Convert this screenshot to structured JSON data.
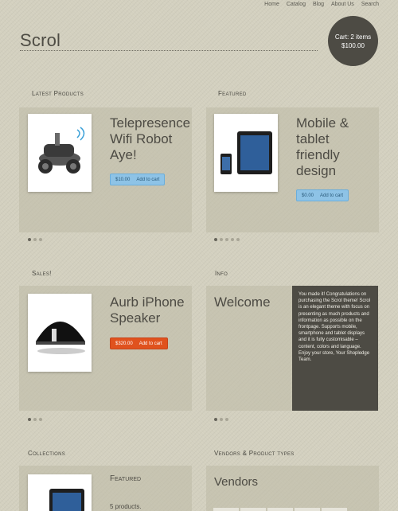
{
  "nav": {
    "items": [
      "Home",
      "Catalog",
      "Blog",
      "About Us",
      "Search"
    ]
  },
  "site": {
    "logo": "Scrol"
  },
  "cart": {
    "line1": "Cart: 2 items",
    "line2": "$100.00"
  },
  "latest": {
    "heading": "Latest Products",
    "product_title": "Telepresence Wifi Robot Aye!",
    "price": "$10.00",
    "add_label": "Add to cart",
    "dots": 3
  },
  "featured": {
    "heading": "Featured",
    "product_title": "Mobile & tablet friendly design",
    "price": "$0.00",
    "add_label": "Add to cart",
    "dots": 5
  },
  "sales": {
    "heading": "Sales!",
    "product_title": "Aurb iPhone Speaker",
    "price": "$320.00",
    "add_label": "Add to cart",
    "dots": 3
  },
  "info": {
    "heading": "Info",
    "title": "Welcome",
    "text": "You made it! Congratulations on purchasing the Scrol theme! Scrol is an elegant theme with focus on presenting as much products and information as possible on the frontpage. Supports mobile, smartphone and tablet displays and it is fully customisable – content, colors and language. Enjoy your store, Your Shopledge Team.",
    "dots": 3
  },
  "collections": {
    "heading": "Collections",
    "title": "Featured",
    "count": "5 products."
  },
  "vendors": {
    "heading": "Vendors & Product types",
    "title": "Vendors"
  },
  "colors": {
    "background": "#d3d0bf",
    "dark": "#4d4b44",
    "accent_blue": "#8ec3e6",
    "accent_orange": "#e0521e"
  }
}
